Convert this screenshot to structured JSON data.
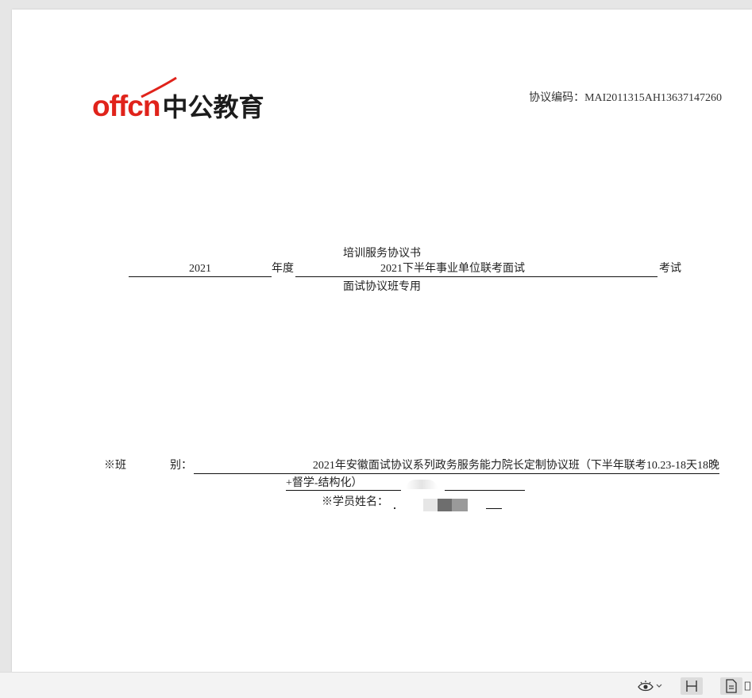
{
  "header": {
    "logo_latin": "offcn",
    "logo_cjk": "中公教育",
    "protocol_code": "协议编码：MAI2011315AH13637147260"
  },
  "title": {
    "main": "培训服务协议书",
    "year": "2021",
    "year_suffix": "年度",
    "exam": "2021下半年事业单位联考面试",
    "exam_suffix": "考试",
    "subtitle": "面试协议班专用"
  },
  "fields": {
    "class_label_1": "※班",
    "class_label_2": "别：",
    "class_value_line1": "2021年安徽面试协议系列政务服务能力院长定制协议班（下半年联考10.23-18天18晚",
    "class_value_line2": "+督学-结构化）",
    "student_label": "※学员姓名："
  },
  "statusbar": {
    "eye_icon": "eye-icon",
    "dropdown_icon": "chevron-down-icon",
    "fit_icon": "fit-width-icon",
    "page_icon": "single-page-icon",
    "more_icon": "page-view-icon"
  },
  "colors": {
    "brand_red": "#e0231b",
    "text": "#222222",
    "page_bg": "#ffffff",
    "viewer_bg": "#e6e6e6"
  }
}
